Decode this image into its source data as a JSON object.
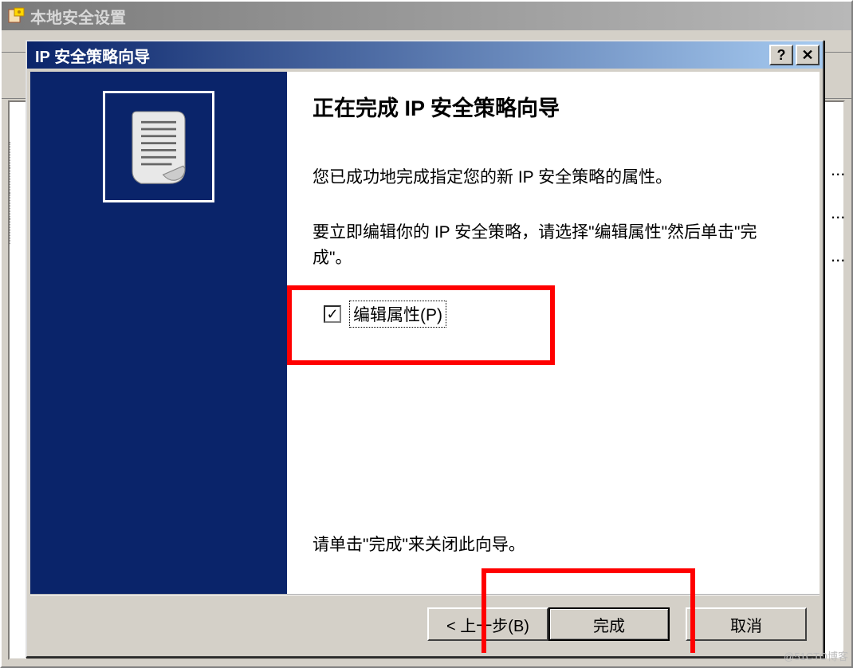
{
  "parent_window": {
    "title": "本地安全设置"
  },
  "dialog": {
    "title": "IP 安全策略向导",
    "help_symbol": "?",
    "close_symbol": "✕"
  },
  "wizard": {
    "heading": "正在完成 IP 安全策略向导",
    "line1": "您已成功地完成指定您的新 IP 安全策略的属性。",
    "line2": "要立即编辑你的 IP 安全策略，请选择\"编辑属性\"然后单击\"完成\"。",
    "checkbox": {
      "checked": true,
      "label": "编辑属性(P)"
    },
    "closing": "请单击\"完成\"来关闭此向导。"
  },
  "buttons": {
    "back": "< 上一步(B)",
    "finish": "完成",
    "cancel": "取消"
  },
  "watermark": "@51CTO博客"
}
